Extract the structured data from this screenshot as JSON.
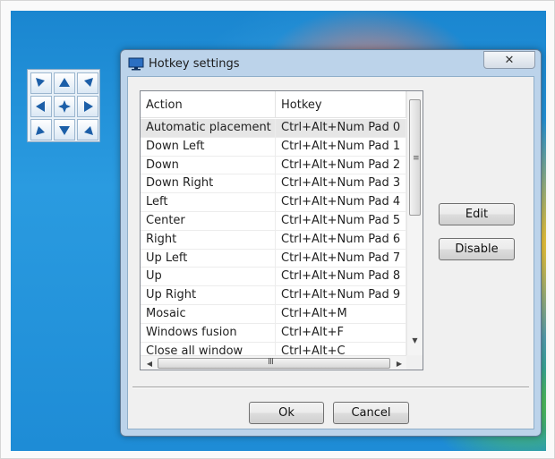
{
  "dialog": {
    "title": "Hotkey settings",
    "close_symbol": "✕"
  },
  "table": {
    "columns": [
      "Action",
      "Hotkey"
    ],
    "rows": [
      {
        "action": "Automatic placement",
        "hotkey": "Ctrl+Alt+Num Pad 0"
      },
      {
        "action": "Down Left",
        "hotkey": "Ctrl+Alt+Num Pad 1"
      },
      {
        "action": "Down",
        "hotkey": "Ctrl+Alt+Num Pad 2"
      },
      {
        "action": "Down Right",
        "hotkey": "Ctrl+Alt+Num Pad 3"
      },
      {
        "action": "Left",
        "hotkey": "Ctrl+Alt+Num Pad 4"
      },
      {
        "action": "Center",
        "hotkey": "Ctrl+Alt+Num Pad 5"
      },
      {
        "action": "Right",
        "hotkey": "Ctrl+Alt+Num Pad 6"
      },
      {
        "action": "Up Left",
        "hotkey": "Ctrl+Alt+Num Pad 7"
      },
      {
        "action": "Up",
        "hotkey": "Ctrl+Alt+Num Pad 8"
      },
      {
        "action": "Up Right",
        "hotkey": "Ctrl+Alt+Num Pad 9"
      },
      {
        "action": "Mosaic",
        "hotkey": "Ctrl+Alt+M"
      },
      {
        "action": "Windows fusion",
        "hotkey": "Ctrl+Alt+F"
      },
      {
        "action": "Close all window",
        "hotkey": "Ctrl+Alt+C"
      }
    ],
    "selected_index": 0
  },
  "buttons": {
    "edit": "Edit",
    "disable": "Disable",
    "ok": "Ok",
    "cancel": "Cancel"
  },
  "arrow_pad": {
    "icons": [
      "arrow-up-left-icon",
      "arrow-up-icon",
      "arrow-up-right-icon",
      "arrow-left-icon",
      "move-center-icon",
      "arrow-right-icon",
      "arrow-down-left-icon",
      "arrow-down-icon",
      "arrow-down-right-icon"
    ],
    "color": "#1c5fa8"
  }
}
